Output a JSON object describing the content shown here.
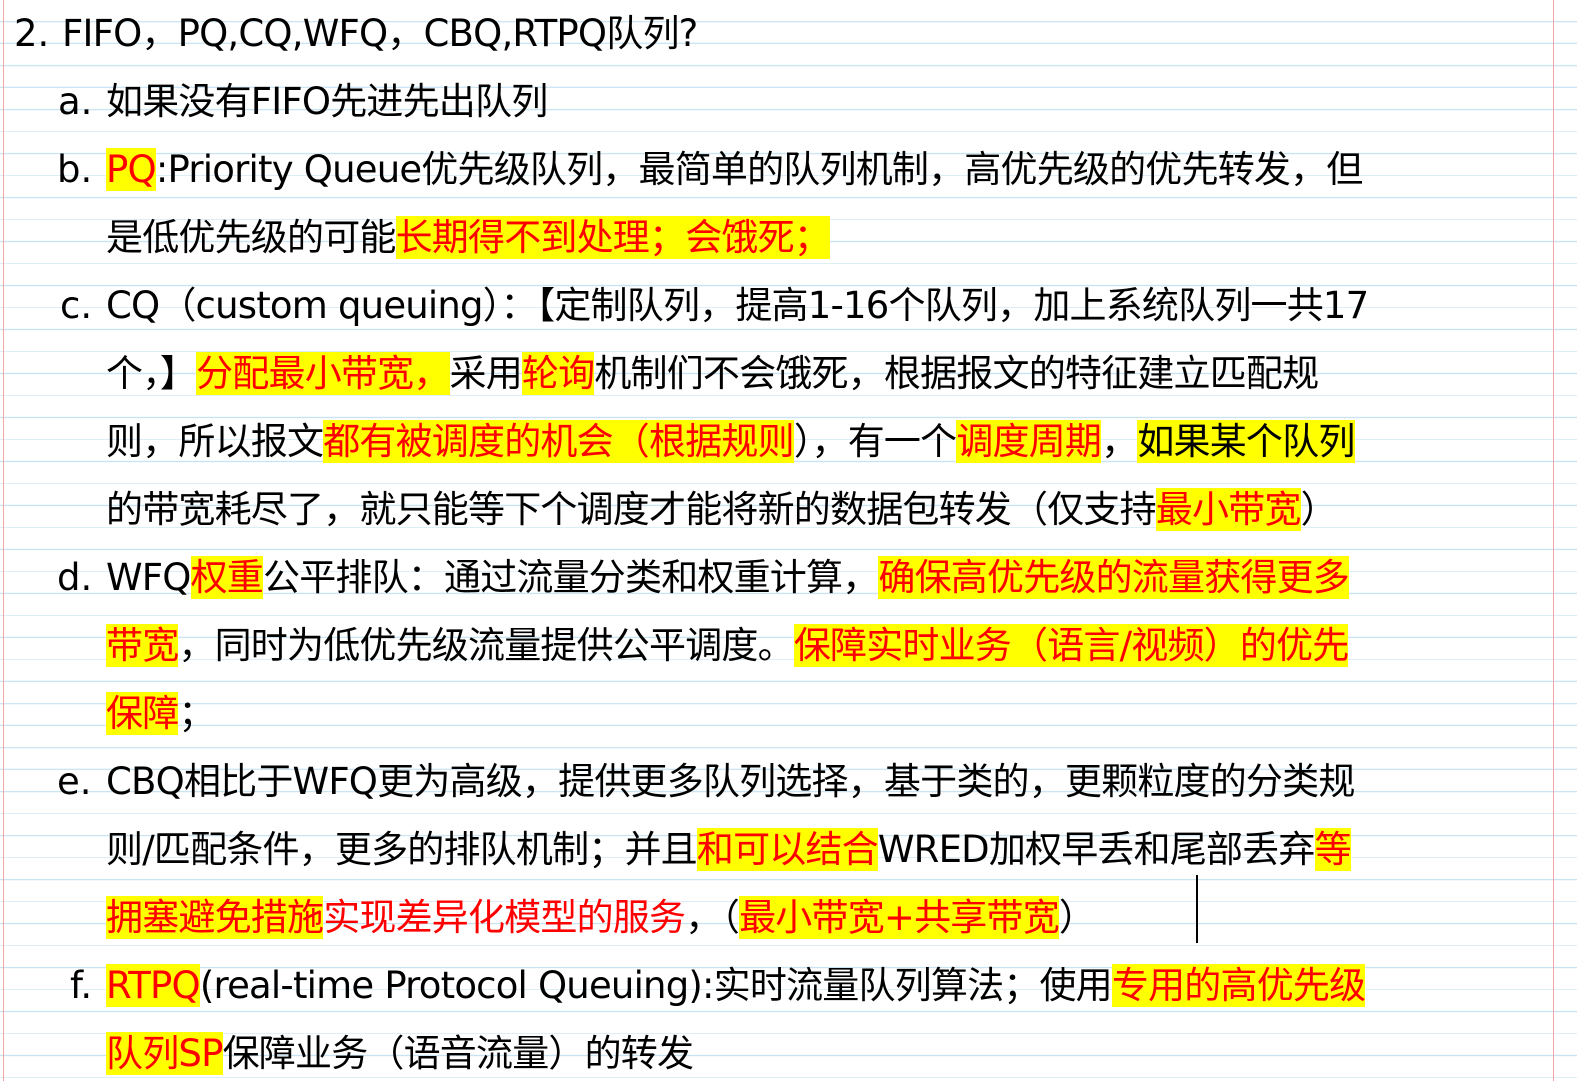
{
  "heading": {
    "number": "2.",
    "text": "FIFO，PQ,CQ,WFQ，CBQ,RTPQ队列?"
  },
  "items": [
    {
      "marker": "a.",
      "lines": [
        [
          {
            "text": "如果没有FIFO先进先出队列"
          }
        ]
      ]
    },
    {
      "marker": "b.",
      "lines": [
        [
          {
            "text": "PQ",
            "style": "hl-red"
          },
          {
            "text": ":Priority Queue优先级队列，最简单的队列机制，高优先级的优先转发，但"
          }
        ],
        [
          {
            "text": "是低优先级的可能"
          },
          {
            "text": "长期得不到处理；会饿死；",
            "style": "hl-red"
          }
        ]
      ]
    },
    {
      "marker": "c.",
      "lines": [
        [
          {
            "text": "CQ（custom queuing）：【定制队列，提高1-16个队列，加上系统队列一共17"
          }
        ],
        [
          {
            "text": "个，】"
          },
          {
            "text": "分配最小带宽，",
            "style": "hl-red"
          },
          {
            "text": "采用"
          },
          {
            "text": "轮询",
            "style": "hl-red"
          },
          {
            "text": "机制们不会饿死，根据报文的特征建立匹配规"
          }
        ],
        [
          {
            "text": "则，所以报文"
          },
          {
            "text": "都有被调度的机会（根据规则",
            "style": "hl-red"
          },
          {
            "text": "），有一个"
          },
          {
            "text": "调度周期",
            "style": "hl-red"
          },
          {
            "text": "，"
          },
          {
            "text": "如果某个队列",
            "style": "hl"
          }
        ],
        [
          {
            "text": "的带宽耗尽了，就只能等下个调度才能将新的数据包转发（仅支持"
          },
          {
            "text": "最小带宽",
            "style": "hl-red"
          },
          {
            "text": "）"
          }
        ]
      ]
    },
    {
      "marker": "d.",
      "lines": [
        [
          {
            "text": "WFQ"
          },
          {
            "text": "权重",
            "style": "hl-red"
          },
          {
            "text": "公平排队：通过流量分类和权重计算，"
          },
          {
            "text": "确保高优先级的流量获得更多",
            "style": "hl-red"
          }
        ],
        [
          {
            "text": "带宽",
            "style": "hl-red"
          },
          {
            "text": "，同时为低优先级流量提供公平调度。"
          },
          {
            "text": "保障实时业务（语言/视频）的优先",
            "style": "hl-red"
          }
        ],
        [
          {
            "text": "保障",
            "style": "hl-red"
          },
          {
            "text": "；"
          }
        ]
      ]
    },
    {
      "marker": "e.",
      "lines": [
        [
          {
            "text": "CBQ相比于WFQ更为高级，提供更多队列选择，基于类的，更颗粒度的分类规"
          }
        ],
        [
          {
            "text": "则/匹配条件，更多的排队机制；并且"
          },
          {
            "text": "和可以结合",
            "style": "hl-red"
          },
          {
            "text": "WRED加权早丢和尾部丢弃"
          },
          {
            "text": "等",
            "style": "hl-red"
          }
        ],
        [
          {
            "text": "拥塞避免措施",
            "style": "hl-red"
          },
          {
            "text": "实现差异化模型的服务",
            "style": "red"
          },
          {
            "text": "，（"
          },
          {
            "text": "最小带宽+共享带宽",
            "style": "hl-red"
          },
          {
            "text": "）"
          }
        ]
      ]
    },
    {
      "marker": "f.",
      "lines": [
        [
          {
            "text": "RTPQ",
            "style": "hl-red"
          },
          {
            "text": "(real-time Protocol Queuing):实时流量队列算法；使用"
          },
          {
            "text": "专用的高优先级",
            "style": "hl-red"
          }
        ],
        [
          {
            "text": "队列SP",
            "style": "hl-red"
          },
          {
            "text": "保障业务（语音流量）的转发"
          }
        ]
      ]
    }
  ],
  "colors": {
    "highlight": "#ffff00",
    "emphasis_text": "#ff0000",
    "ruled_line": "#c9e3f2",
    "margin_line": "#f2a7a7"
  }
}
